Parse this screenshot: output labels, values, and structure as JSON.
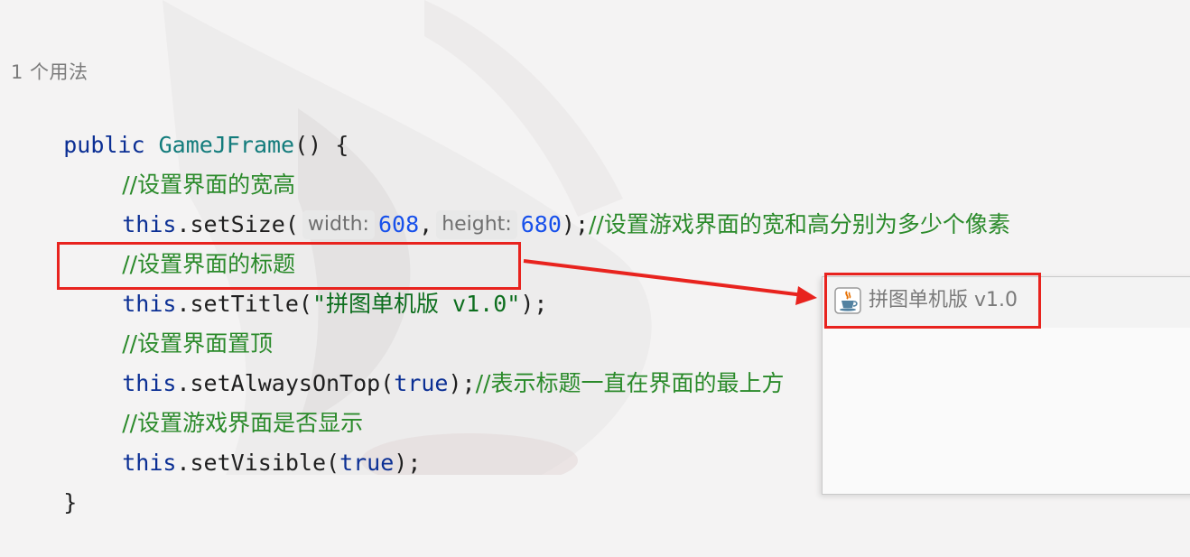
{
  "usage_hint": "1 个用法",
  "code": {
    "l1": {
      "kw": "public",
      "fn": "GameJFrame",
      "rest": "() {"
    },
    "l2": {
      "comment": "//设置界面的宽高"
    },
    "l3": {
      "kw": "this",
      "call": ".setSize(",
      "hint1": "width:",
      "num1": "608",
      "sep": ",",
      "hint2": "height:",
      "num2": "680",
      "close": ");",
      "comment": "//设置游戏界面的宽和高分别为多少个像素"
    },
    "l4": {
      "comment": "//设置界面的标题"
    },
    "l5": {
      "kw": "this",
      "call": ".setTitle(",
      "str": "\"拼图单机版 v1.0\"",
      "close": ");"
    },
    "l6": {
      "comment": "//设置界面置顶"
    },
    "l7": {
      "kw": "this",
      "call": ".setAlwaysOnTop(",
      "kw2": "true",
      "close": ");",
      "comment": "//表示标题一直在界面的最上方"
    },
    "l8": {
      "comment": "//设置游戏界面是否显示"
    },
    "l9": {
      "kw": "this",
      "call": ".setVisible(",
      "kw2": "true",
      "close": ");"
    },
    "l10": {
      "brace": "}"
    }
  },
  "window": {
    "title": "拼图单机版 v1.0",
    "icon": "java-cup-icon"
  },
  "colors": {
    "highlight": "#e8231e",
    "keyword": "#0b2f94",
    "comment": "#2a8a2a",
    "number": "#1750eb",
    "string": "#0d6e1e"
  }
}
